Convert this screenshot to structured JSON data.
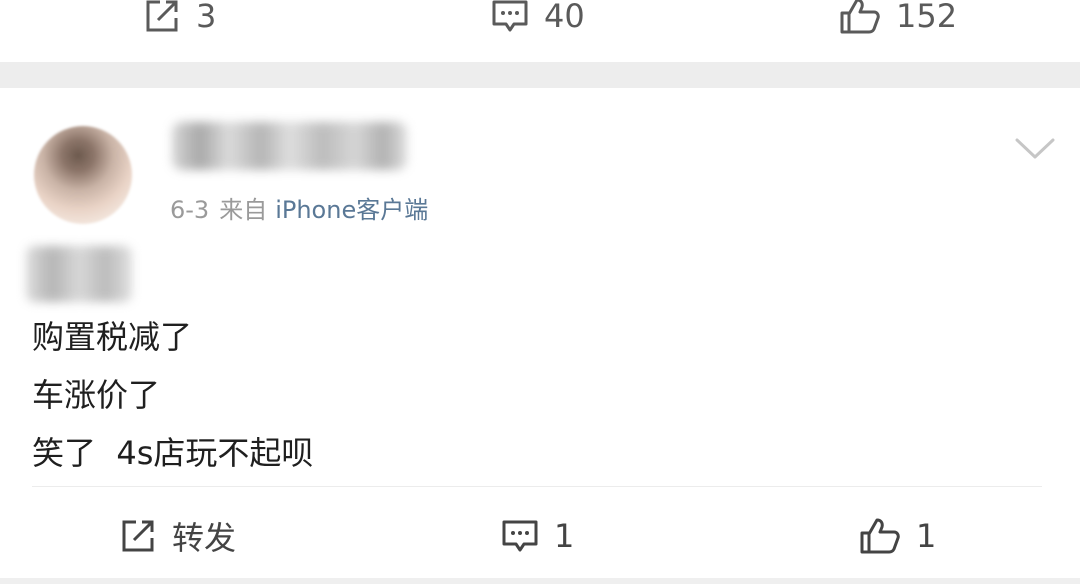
{
  "prev_post_actions": {
    "repost_count": "3",
    "comment_count": "40",
    "like_count": "152"
  },
  "post": {
    "date": "6-3",
    "source_prefix": "来自",
    "source_client": "iPhone客户端",
    "lines": [
      "购置税减了",
      "车涨价了",
      "笑了  4s店玩不起呗"
    ],
    "actions": {
      "repost_label": "转发",
      "comment_count": "1",
      "like_count": "1"
    }
  },
  "icons": {
    "repost": "share-icon",
    "comment": "comment-icon",
    "like": "thumbs-up-icon",
    "more": "chevron-down-icon"
  },
  "colors": {
    "link": "#5a7896",
    "meta": "#9a9a9a",
    "icon": "#5a5a5a",
    "separator": "#ededed"
  }
}
